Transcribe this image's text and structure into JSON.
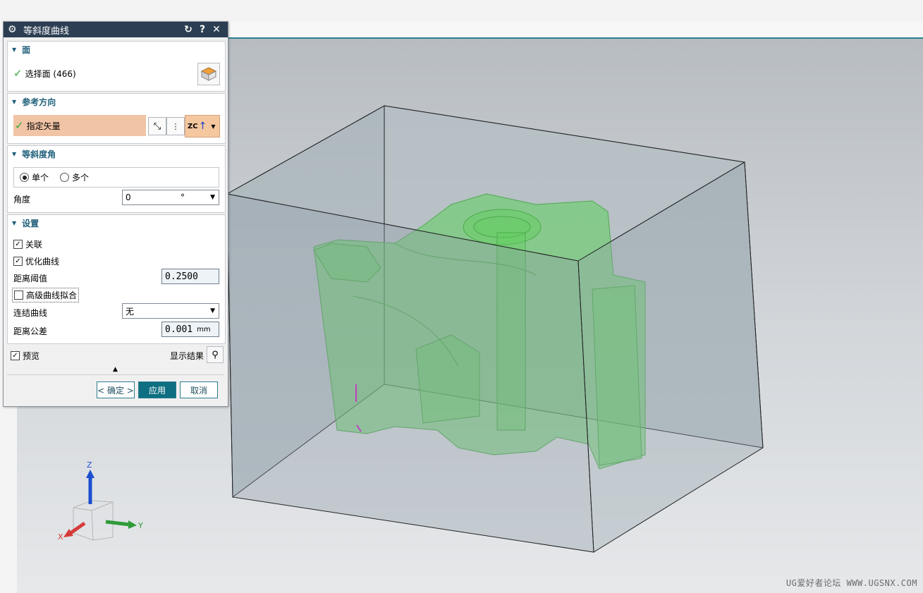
{
  "dialog": {
    "title": "等斜度曲线",
    "face_section": {
      "header": "面",
      "select_label": "选择面 (466)"
    },
    "ref_dir_section": {
      "header": "参考方向",
      "specify_vector_label": "指定矢量",
      "vector_dropdown_label": "ZC"
    },
    "isocline_section": {
      "header": "等斜度角",
      "radio_single": "单个",
      "radio_multi": "多个",
      "angle_label": "角度",
      "angle_value": "0",
      "angle_unit": "°"
    },
    "settings_section": {
      "header": "设置",
      "associative_label": "关联",
      "associative_checked": true,
      "optimize_label": "优化曲线",
      "optimize_checked": true,
      "distance_threshold_label": "距离阈值",
      "distance_threshold_value": "0.2500",
      "advanced_fit_label": "高级曲线拟合",
      "advanced_fit_checked": false,
      "join_curves_label": "连结曲线",
      "join_curves_value": "无",
      "distance_tolerance_label": "距离公差",
      "distance_tolerance_value": "0.001",
      "distance_tolerance_unit": "mm"
    },
    "preview_label": "预览",
    "show_result_label": "显示结果",
    "ok_button": "< 确定 >",
    "apply_button": "应用",
    "cancel_button": "取消"
  },
  "triad": {
    "z_label": "Z",
    "y_label": "Y",
    "x_label": "X"
  },
  "watermark": "UG爱好者论坛 WWW.UGSNX.COM",
  "colors": {
    "title_bar": "#2b3e52",
    "accent": "#0f6f82",
    "model_green": "#5ccb5a",
    "box_face": "#8d9ca6"
  }
}
